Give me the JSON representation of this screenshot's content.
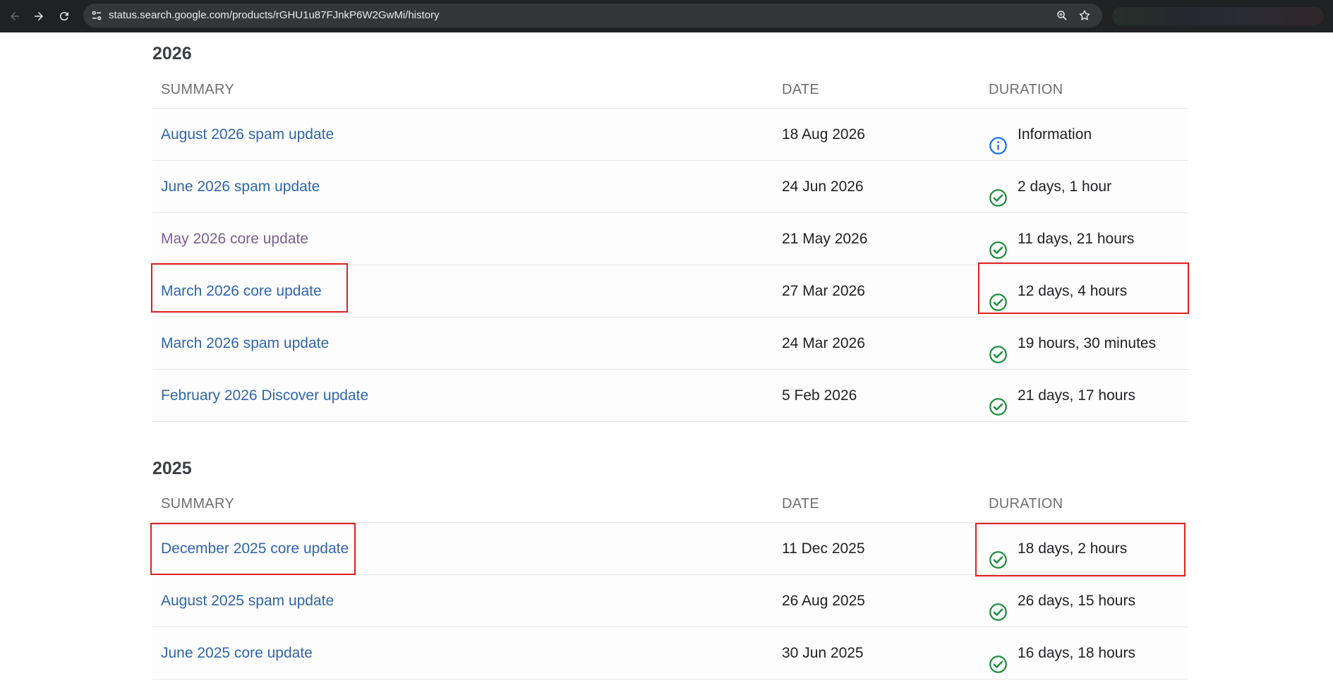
{
  "browser": {
    "url": "status.search.google.com/products/rGHU1u87FJnkP6W2GwMi/history",
    "back_icon": "back-arrow-icon",
    "forward_icon": "forward-arrow-icon",
    "reload_icon": "reload-icon",
    "site_info_icon": "site-settings-icon",
    "zoom_icon": "zoom-icon",
    "bookmark_icon": "star-icon"
  },
  "columns": {
    "summary": "SUMMARY",
    "date": "DATE",
    "duration": "DURATION"
  },
  "colors": {
    "link": "#2f65ad",
    "visited_link": "#7a5d96",
    "success": "#1e8e3e",
    "info": "#1a73e8",
    "highlight": "#e0201e"
  },
  "sections": [
    {
      "year": "2026",
      "rows": [
        {
          "summary": "August 2026 spam update",
          "date": "18 Aug 2026",
          "duration": "Information",
          "status_icon": "info-icon"
        },
        {
          "summary": "June 2026 spam update",
          "date": "24 Jun 2026",
          "duration": "2 days, 1 hour",
          "status_icon": "check-circle-icon"
        },
        {
          "summary": "May 2026 core update",
          "date": "21 May 2026",
          "duration": "11 days, 21 hours",
          "status_icon": "check-circle-icon",
          "visited": true
        },
        {
          "summary": "March 2026 core update",
          "date": "27 Mar 2026",
          "duration": "12 days, 4 hours",
          "status_icon": "check-circle-icon",
          "highlighted": true
        },
        {
          "summary": "March 2026 spam update",
          "date": "24 Mar 2026",
          "duration": "19 hours, 30 minutes",
          "status_icon": "check-circle-icon"
        },
        {
          "summary": "February 2026 Discover update",
          "date": "5 Feb 2026",
          "duration": "21 days, 17 hours",
          "status_icon": "check-circle-icon"
        }
      ]
    },
    {
      "year": "2025",
      "rows": [
        {
          "summary": "December 2025 core update",
          "date": "11 Dec 2025",
          "duration": "18 days, 2 hours",
          "status_icon": "check-circle-icon",
          "highlighted": true
        },
        {
          "summary": "August 2025 spam update",
          "date": "26 Aug 2025",
          "duration": "26 days, 15 hours",
          "status_icon": "check-circle-icon"
        },
        {
          "summary": "June 2025 core update",
          "date": "30 Jun 2025",
          "duration": "16 days, 18 hours",
          "status_icon": "check-circle-icon"
        }
      ]
    }
  ]
}
